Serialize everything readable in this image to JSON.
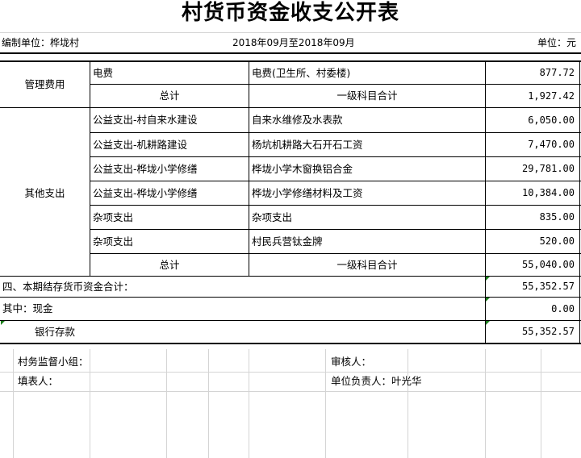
{
  "title": "村货币资金收支公开表",
  "header": {
    "unit_label": "编制单位：桦垅村",
    "period": "2018年09月至2018年09月",
    "currency": "单位：元"
  },
  "management": {
    "category": "管理费用",
    "rows": [
      {
        "item": "电费",
        "detail": "电费(卫生所、村委楼)",
        "amount": "877.72"
      }
    ],
    "total_label": "总计",
    "total_desc": "一级科目合计",
    "total_amount": "1,927.42"
  },
  "other": {
    "category": "其他支出",
    "rows": [
      {
        "item": "公益支出-村自来水建设",
        "detail": "自来水维修及水表款",
        "amount": "6,050.00"
      },
      {
        "item": "公益支出-机耕路建设",
        "detail": "杨坑机耕路大石开石工资",
        "amount": "7,470.00"
      },
      {
        "item": "公益支出-桦垅小学修缮",
        "detail": "桦垅小学木窗换铝合金",
        "amount": "29,781.00"
      },
      {
        "item": "公益支出-桦垅小学修缮",
        "detail": "桦垅小学修缮材料及工资",
        "amount": "10,384.00"
      },
      {
        "item": "杂项支出",
        "detail": "杂项支出",
        "amount": "835.00"
      },
      {
        "item": "杂项支出",
        "detail": "村民兵营钛金牌",
        "amount": "520.00"
      }
    ],
    "total_label": "总计",
    "total_desc": "一级科目合计",
    "total_amount": "55,040.00"
  },
  "summary": [
    {
      "label": "四、本期结存货币资金合计：",
      "amount": "55,352.57"
    },
    {
      "label": "其中：现金",
      "amount": "0.00"
    },
    {
      "label": "银行存款",
      "amount": "55,352.57"
    }
  ],
  "signatures": {
    "supervision": "村务监督小组：",
    "reviewer": "审核人：",
    "preparer": "填表人：",
    "leader": "单位负责人：叶光华"
  },
  "colors": {
    "error_indicator": "#1a7f1a",
    "grid": "#d4d4d4"
  }
}
